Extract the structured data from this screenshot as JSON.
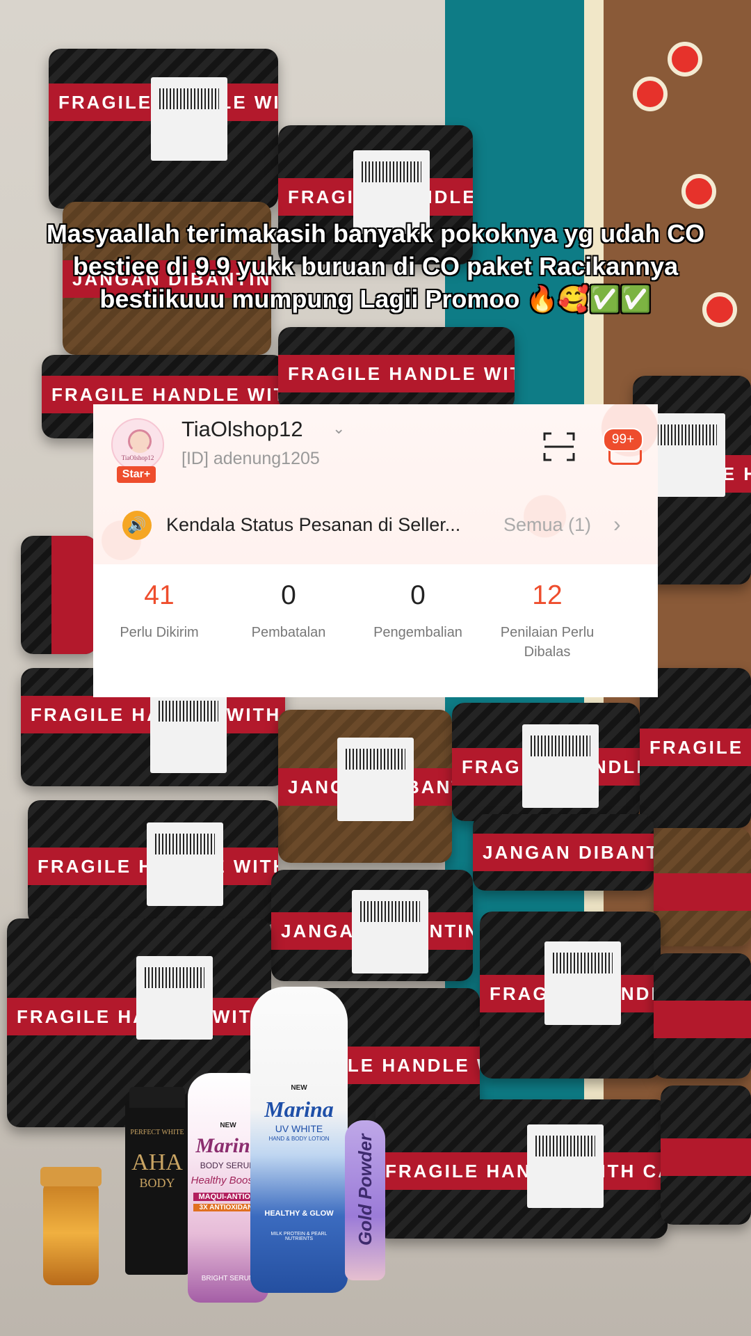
{
  "caption": "Masyaallah terimakasih banyakk pokoknya yg udah CO bestiee di 9.9 yukk buruan di CO paket Racikannya bestiikuuu mumpung Lagii Promoo 🔥🥰✅✅",
  "shop": {
    "avatar_text": "TiaOlshop12",
    "badge": "Star+",
    "name": "TiaOlshop12",
    "id": "[ID] adenung1205",
    "notification_count": "99+"
  },
  "announcement": {
    "text": "Kendala Status Pesanan di Seller...",
    "all_label": "Semua (1)"
  },
  "stats": [
    {
      "value": "41",
      "label": "Perlu Dikirim"
    },
    {
      "value": "0",
      "label": "Pembatalan"
    },
    {
      "value": "0",
      "label": "Pengembalian"
    },
    {
      "value": "12",
      "label": "Penilaian Perlu Dibalas"
    }
  ],
  "packaging": {
    "tape_text": "FRAGILE HANDLE WITH CARE",
    "tape_text_2": "JANGAN DIBANTING"
  },
  "products": {
    "black_tube": {
      "line1": "PERFECT WHITE",
      "line2": "AHA",
      "line3": "BODY"
    },
    "pink_bottle": {
      "new": "NEW",
      "brand": "Marina",
      "line1": "BODY SERUM",
      "line2": "Healthy Booster",
      "line3": "MAQUI-ANTIOXI",
      "line4": "3X ANTIOXIDANT",
      "line5": "BRIGHT SERUM"
    },
    "blue_bottle": {
      "new": "NEW",
      "brand": "Marina",
      "line1": "UV WHITE",
      "line2": "HAND & BODY LOTION",
      "line3": "HEALTHY & GLOW",
      "line4": "MILK PROTEIN & PEARL NUTRIENTS"
    },
    "purple_tube": {
      "text": "Gold Powder"
    }
  },
  "colors": {
    "accent": "#ee4d2d",
    "tape": "#b3192c",
    "rug": "#0e7c86"
  }
}
